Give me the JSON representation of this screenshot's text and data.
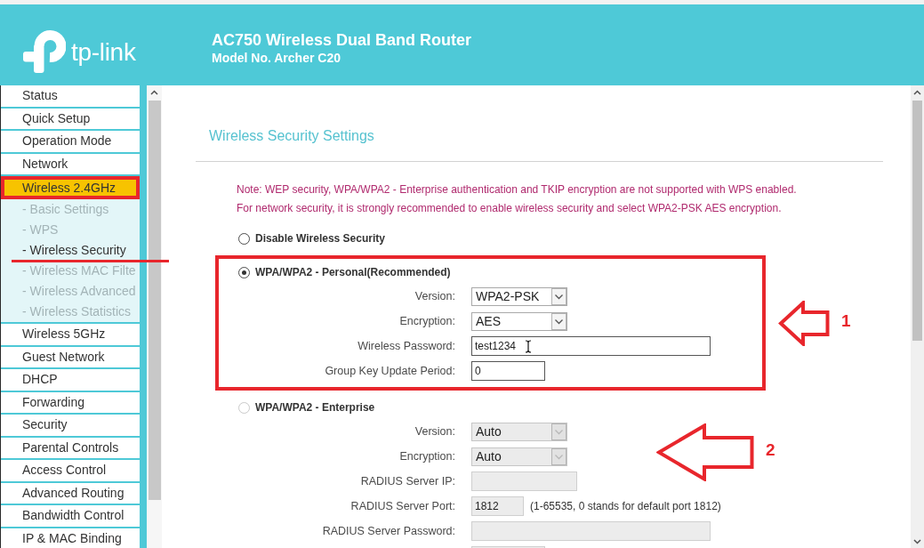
{
  "header": {
    "logo_text": "tp-link",
    "title": "AC750 Wireless Dual Band Router",
    "subtitle": "Model No. Archer C20"
  },
  "sidebar": {
    "items": [
      {
        "label": "Status",
        "highlighted": false
      },
      {
        "label": "Quick Setup",
        "highlighted": false
      },
      {
        "label": "Operation Mode",
        "highlighted": false
      },
      {
        "label": "Network",
        "highlighted": false
      },
      {
        "label": "Wireless 2.4GHz",
        "highlighted": true,
        "children": [
          {
            "label": "- Basic Settings",
            "selected": false,
            "underlined": false
          },
          {
            "label": "- WPS",
            "selected": false,
            "underlined": false
          },
          {
            "label": "- Wireless Security",
            "selected": true,
            "underlined": true
          },
          {
            "label": "- Wireless MAC Filte",
            "selected": false,
            "underlined": false
          },
          {
            "label": "- Wireless Advanced",
            "selected": false,
            "underlined": false
          },
          {
            "label": "- Wireless Statistics",
            "selected": false,
            "underlined": false
          }
        ]
      },
      {
        "label": "Wireless 5GHz",
        "highlighted": false
      },
      {
        "label": "Guest Network",
        "highlighted": false
      },
      {
        "label": "DHCP",
        "highlighted": false
      },
      {
        "label": "Forwarding",
        "highlighted": false
      },
      {
        "label": "Security",
        "highlighted": false
      },
      {
        "label": "Parental Controls",
        "highlighted": false
      },
      {
        "label": "Access Control",
        "highlighted": false
      },
      {
        "label": "Advanced Routing",
        "highlighted": false
      },
      {
        "label": "Bandwidth Control",
        "highlighted": false
      },
      {
        "label": "IP & MAC Binding",
        "highlighted": false
      }
    ]
  },
  "content": {
    "title": "Wireless Security Settings",
    "notes": [
      "Note: WEP security, WPA/WPA2 - Enterprise authentication and TKIP encryption are not supported with WPS enabled.",
      "For network security, it is strongly recommended to enable wireless security and select WPA2-PSK AES encryption."
    ],
    "options": [
      {
        "label": "Disable Wireless Security",
        "selected": false,
        "disabled": false,
        "boxed": false
      },
      {
        "label": "WPA/WPA2 - Personal(Recommended)",
        "selected": true,
        "disabled": false,
        "boxed": true,
        "callout": "1",
        "fields": [
          {
            "label": "Version:",
            "kind": "select",
            "value": "WPA2-PSK",
            "hovered": false
          },
          {
            "label": "Encryption:",
            "kind": "select",
            "value": "AES",
            "hovered": false
          },
          {
            "label": "Wireless Password:",
            "kind": "input",
            "value": "test1234",
            "hovered": true
          },
          {
            "label": "Group Key Update Period:",
            "kind": "input",
            "value": "0",
            "hovered": false
          }
        ]
      },
      {
        "label": "WPA/WPA2 - Enterprise",
        "selected": false,
        "disabled": true,
        "boxed": false,
        "callout": "2",
        "fields": [
          {
            "label": "Version:",
            "kind": "select",
            "value": "Auto",
            "hovered": false
          },
          {
            "label": "Encryption:",
            "kind": "select",
            "value": "Auto",
            "hovered": false
          },
          {
            "label": "RADIUS Server IP:",
            "kind": "input",
            "hovered": false
          },
          {
            "label": "RADIUS Server Port:",
            "kind": "input",
            "value": "1812",
            "hint": "(1-65535, 0 stands for default port 1812)",
            "hovered": false
          },
          {
            "label": "RADIUS Server Password:",
            "kind": "input",
            "hovered": false
          },
          {
            "kind": "input",
            "hovered": false
          }
        ]
      }
    ]
  }
}
